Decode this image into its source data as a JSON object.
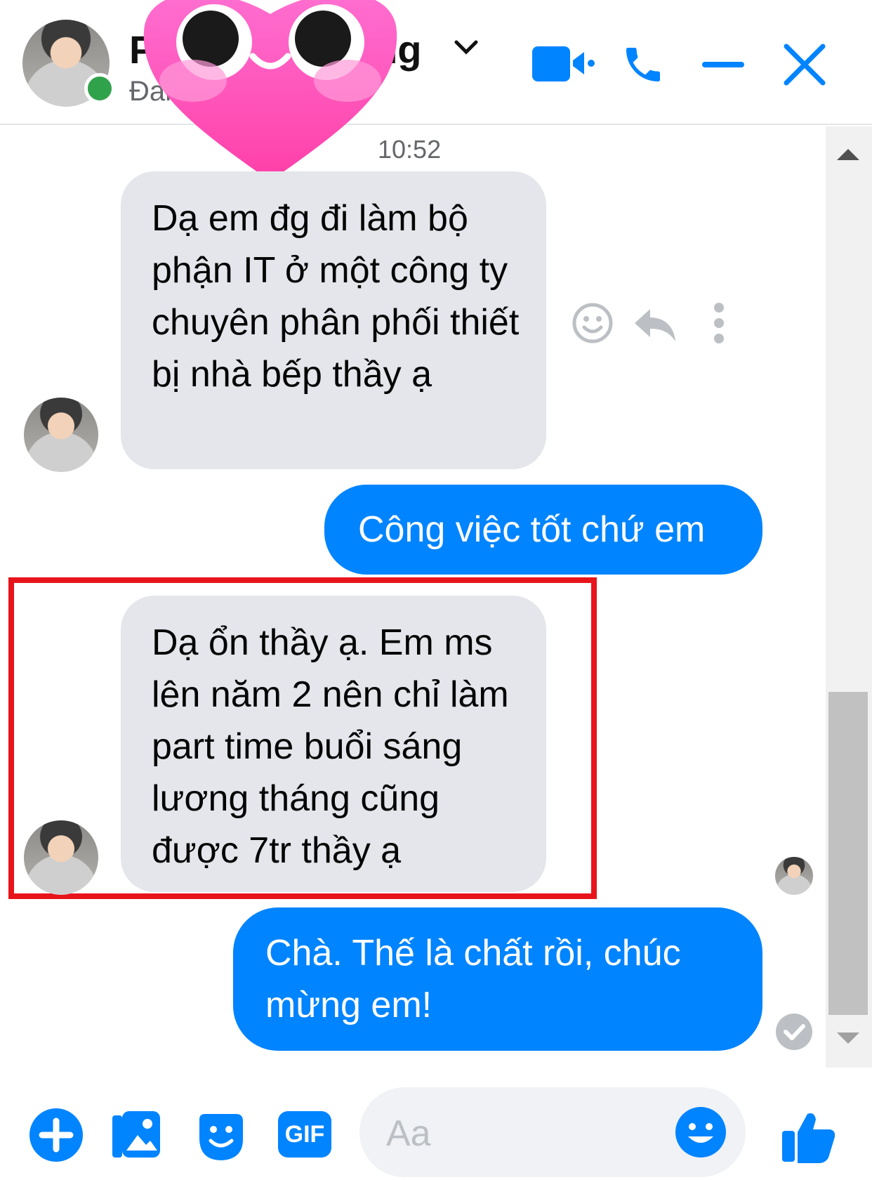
{
  "header": {
    "name_visible_left": "P",
    "name_visible_right": "ng",
    "status_visible": "Đan",
    "status_color": "#31a24c",
    "icon_color": "#0084ff"
  },
  "thread": {
    "timestamp": "10:52",
    "messages": [
      {
        "side": "in",
        "text": "Dạ em đg đi làm bộ phận IT ở một công ty chuyên phân phối thiết bị nhà bếp thầy ạ"
      },
      {
        "side": "out",
        "text": "Công việc tốt chứ em"
      },
      {
        "side": "in",
        "text": "Dạ ổn thầy ạ. Em ms lên năm 2 nên chỉ làm part time buổi sáng lương tháng cũng được 7tr thầy ạ",
        "highlighted": true
      },
      {
        "side": "out",
        "text": "Chà. Thế là chất rồi, chúc mừng em!"
      }
    ],
    "highlight_color": "#e8141b"
  },
  "composer": {
    "placeholder": "Aa",
    "gif_label": "GIF"
  }
}
